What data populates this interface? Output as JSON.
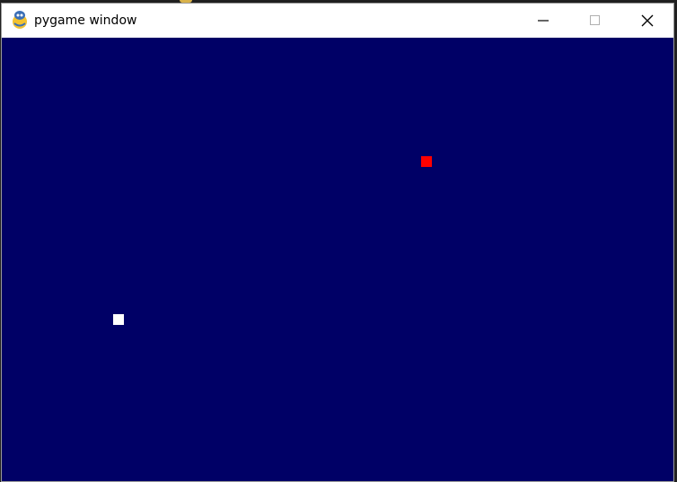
{
  "window": {
    "title": "pygame window",
    "app_icon": "pygame-snake-icon",
    "controls": {
      "minimize_icon": "minimize-icon",
      "maximize_icon": "maximize-icon",
      "close_icon": "close-icon"
    }
  },
  "game": {
    "background_color": "#000066",
    "objects": [
      {
        "kind": "food",
        "color": "#ff0000"
      },
      {
        "kind": "player",
        "color": "#ffffff"
      }
    ]
  }
}
